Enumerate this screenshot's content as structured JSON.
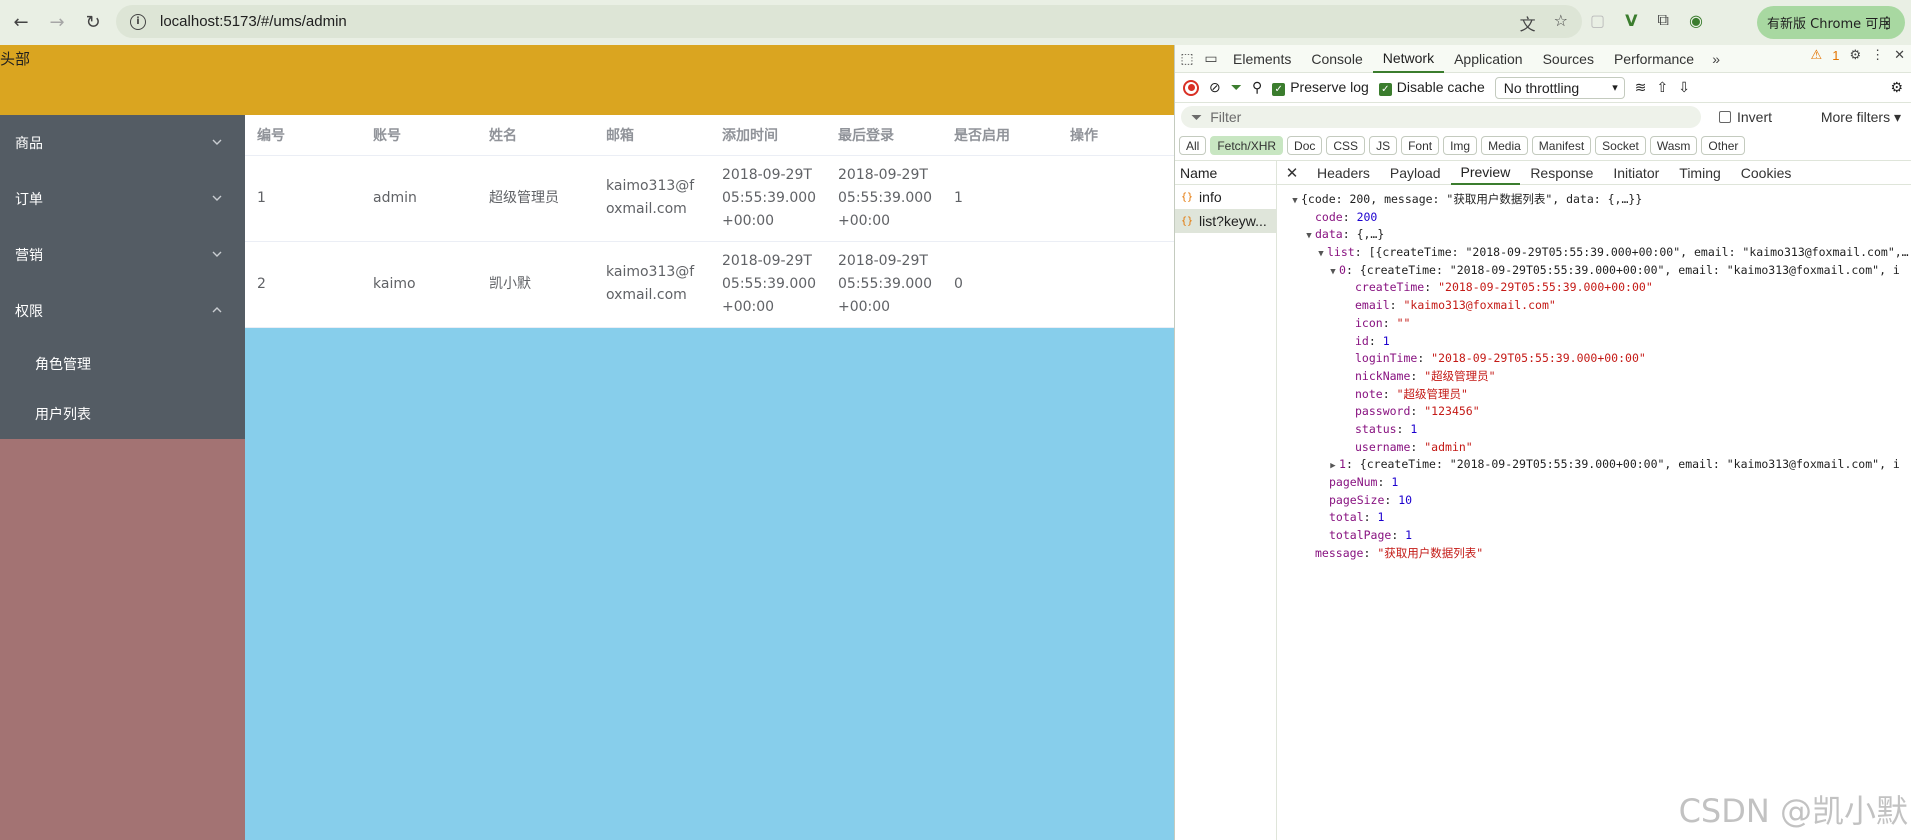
{
  "browser": {
    "url": "localhost:5173/#/ums/admin",
    "update_label": "有新版 Chrome 可用"
  },
  "page": {
    "header_text": "头部",
    "menu": [
      {
        "label": "商品"
      },
      {
        "label": "订单"
      },
      {
        "label": "营销"
      },
      {
        "label": "权限"
      }
    ],
    "submenu": [
      "角色管理",
      "用户列表"
    ],
    "table": {
      "columns": [
        "编号",
        "账号",
        "姓名",
        "邮箱",
        "添加时间",
        "最后登录",
        "是否启用",
        "操作"
      ],
      "rows": [
        [
          "1",
          "admin",
          "超级管理员",
          "kaimo313@foxmail.com",
          "2018-09-29T05:55:39.000+00:00",
          "2018-09-29T05:55:39.000+00:00",
          "1",
          ""
        ],
        [
          "2",
          "kaimo",
          "凯小默",
          "kaimo313@foxmail.com",
          "2018-09-29T05:55:39.000+00:00",
          "2018-09-29T05:55:39.000+00:00",
          "0",
          ""
        ]
      ]
    }
  },
  "devtools": {
    "tabs": [
      "Elements",
      "Console",
      "Network",
      "Application",
      "Sources",
      "Performance"
    ],
    "warning_count": "1",
    "toolbar": {
      "preserve_log": "Preserve log",
      "disable_cache": "Disable cache",
      "throttling": "No throttling"
    },
    "filter_placeholder": "Filter",
    "invert_label": "Invert",
    "more_filters": "More filters",
    "types": [
      "All",
      "Fetch/XHR",
      "Doc",
      "CSS",
      "JS",
      "Font",
      "Img",
      "Media",
      "Manifest",
      "Socket",
      "Wasm",
      "Other"
    ],
    "name_header": "Name",
    "requests": [
      "info",
      "list?keyw..."
    ],
    "detail_tabs": [
      "Headers",
      "Payload",
      "Preview",
      "Response",
      "Initiator",
      "Timing",
      "Cookies"
    ],
    "preview": {
      "summary": "{code: 200, message: \"获取用户数据列表\", data: {,…}}",
      "code": "200",
      "data_summary": "{,…}",
      "list_summary": "[{createTime: \"2018-09-29T05:55:39.000+00:00\", email: \"kaimo313@foxmail.com\",…",
      "item0_summary": "{createTime: \"2018-09-29T05:55:39.000+00:00\", email: \"kaimo313@foxmail.com\", i",
      "item0": {
        "createTime": "\"2018-09-29T05:55:39.000+00:00\"",
        "email": "\"kaimo313@foxmail.com\"",
        "icon": "\"\"",
        "id": "1",
        "loginTime": "\"2018-09-29T05:55:39.000+00:00\"",
        "nickName": "\"超级管理员\"",
        "note": "\"超级管理员\"",
        "password": "\"123456\"",
        "status": "1",
        "username": "\"admin\""
      },
      "item1_summary": "{createTime: \"2018-09-29T05:55:39.000+00:00\", email: \"kaimo313@foxmail.com\", i",
      "pageNum": "1",
      "pageSize": "10",
      "total": "1",
      "totalPage": "1",
      "message": "\"获取用户数据列表\""
    }
  },
  "watermark": "CSDN @凯小默"
}
